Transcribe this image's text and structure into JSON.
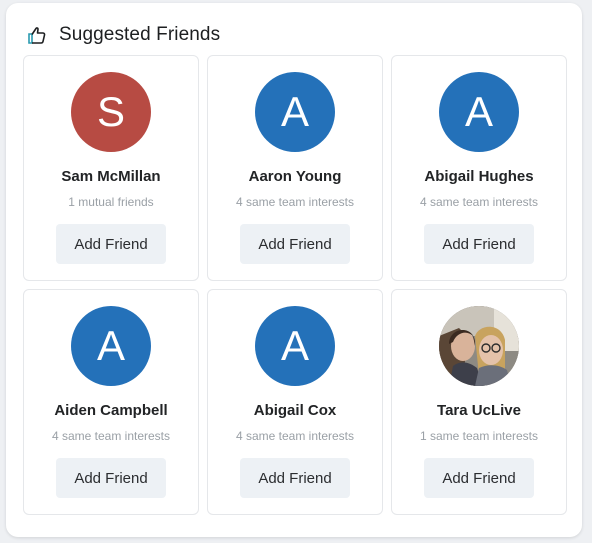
{
  "header": {
    "title": "Suggested Friends",
    "icon": "thumbs-up-icon"
  },
  "colors": {
    "avatar_blue": "#2471b9",
    "avatar_red": "#b74b43",
    "button_bg": "#edf1f5",
    "icon_accent": "#2a9bb0"
  },
  "friends": [
    {
      "initial": "S",
      "name": "Sam McMillan",
      "info": "1 mutual friends",
      "button": "Add Friend",
      "avatar_color": "#b74b43",
      "avatar_type": "initial"
    },
    {
      "initial": "A",
      "name": "Aaron Young",
      "info": "4 same team interests",
      "button": "Add Friend",
      "avatar_color": "#2471b9",
      "avatar_type": "initial"
    },
    {
      "initial": "A",
      "name": "Abigail Hughes",
      "info": "4 same team interests",
      "button": "Add Friend",
      "avatar_color": "#2471b9",
      "avatar_type": "initial"
    },
    {
      "initial": "A",
      "name": "Aiden Campbell",
      "info": "4 same team interests",
      "button": "Add Friend",
      "avatar_color": "#2471b9",
      "avatar_type": "initial"
    },
    {
      "initial": "A",
      "name": "Abigail Cox",
      "info": "4 same team interests",
      "button": "Add Friend",
      "avatar_color": "#2471b9",
      "avatar_type": "initial"
    },
    {
      "initial": "",
      "name": "Tara UcLive",
      "info": "1 same team interests",
      "button": "Add Friend",
      "avatar_color": "",
      "avatar_type": "photo"
    }
  ]
}
